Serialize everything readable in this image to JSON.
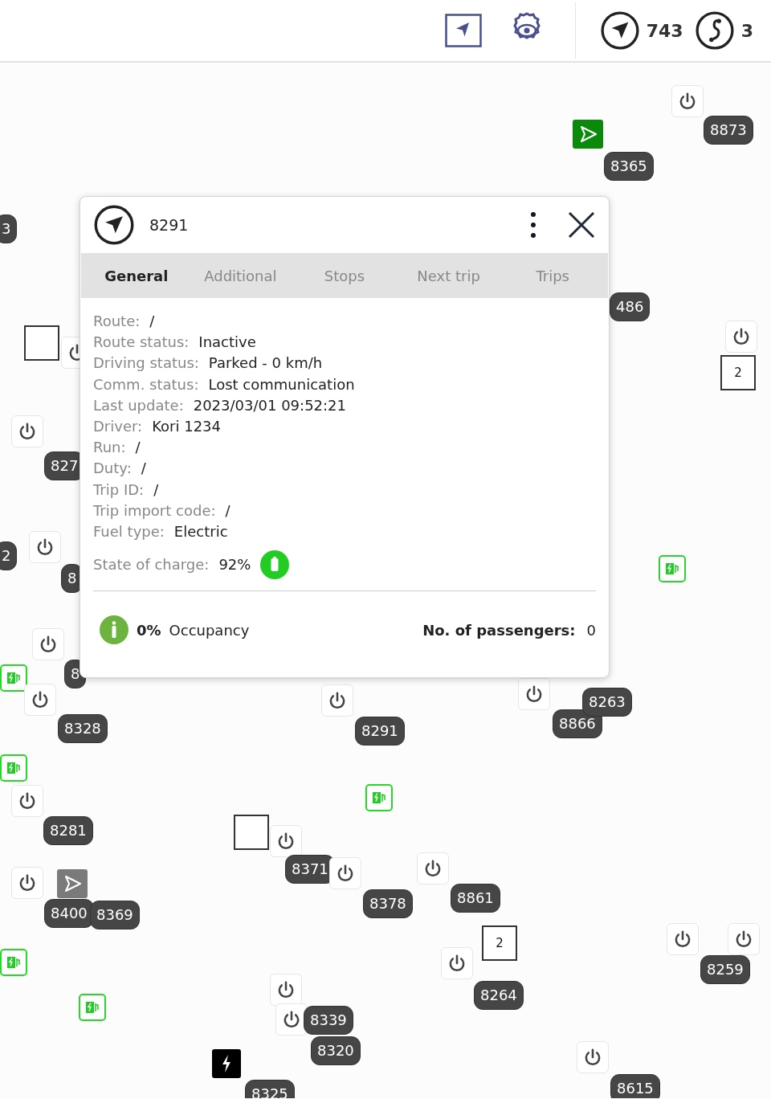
{
  "toolbar": {
    "counters": [
      {
        "kind": "vehicles",
        "count": "743"
      },
      {
        "kind": "routes",
        "count": "3"
      }
    ]
  },
  "map": {
    "markers": [
      {
        "kind": "power"
      },
      {
        "kind": "label",
        "text": "8873"
      },
      {
        "kind": "arrow",
        "active": true
      },
      {
        "kind": "label",
        "text": "8365"
      },
      {
        "kind": "label",
        "text": "3"
      },
      {
        "kind": "label",
        "text": "486"
      },
      {
        "kind": "box"
      },
      {
        "kind": "power"
      },
      {
        "kind": "box",
        "text": "2"
      },
      {
        "kind": "power"
      },
      {
        "kind": "power"
      },
      {
        "kind": "label",
        "text": "827"
      },
      {
        "kind": "label",
        "text": "2"
      },
      {
        "kind": "power"
      },
      {
        "kind": "label",
        "text": "8"
      },
      {
        "kind": "charger"
      },
      {
        "kind": "power"
      },
      {
        "kind": "label",
        "text": "8"
      },
      {
        "kind": "charger"
      },
      {
        "kind": "power"
      },
      {
        "kind": "label",
        "text": "8328"
      },
      {
        "kind": "power"
      },
      {
        "kind": "label",
        "text": "8291"
      },
      {
        "kind": "power"
      },
      {
        "kind": "label",
        "text": "8866"
      },
      {
        "kind": "label",
        "text": "8263"
      },
      {
        "kind": "charger"
      },
      {
        "kind": "power"
      },
      {
        "kind": "label",
        "text": "8281"
      },
      {
        "kind": "charger"
      },
      {
        "kind": "box"
      },
      {
        "kind": "power"
      },
      {
        "kind": "label",
        "text": "8371"
      },
      {
        "kind": "power"
      },
      {
        "kind": "power"
      },
      {
        "kind": "label",
        "text": "8378"
      },
      {
        "kind": "label",
        "text": "8861"
      },
      {
        "kind": "power"
      },
      {
        "kind": "arrow",
        "active": false
      },
      {
        "kind": "label",
        "text": "8400"
      },
      {
        "kind": "label",
        "text": "8369"
      },
      {
        "kind": "box",
        "text": "2"
      },
      {
        "kind": "power"
      },
      {
        "kind": "label",
        "text": "8264"
      },
      {
        "kind": "power"
      },
      {
        "kind": "power"
      },
      {
        "kind": "label",
        "text": "8259"
      },
      {
        "kind": "charger"
      },
      {
        "kind": "charger"
      },
      {
        "kind": "power"
      },
      {
        "kind": "power"
      },
      {
        "kind": "label",
        "text": "8339"
      },
      {
        "kind": "label",
        "text": "8320"
      },
      {
        "kind": "bolt"
      },
      {
        "kind": "label",
        "text": "8325"
      },
      {
        "kind": "power"
      },
      {
        "kind": "label",
        "text": "8615"
      }
    ]
  },
  "popup": {
    "vehicle": "8291",
    "tabs": [
      {
        "label": "General",
        "selected": true
      },
      {
        "label": "Additional",
        "selected": false
      },
      {
        "label": "Stops",
        "selected": false
      },
      {
        "label": "Next trip",
        "selected": false
      },
      {
        "label": "Trips",
        "selected": false
      }
    ],
    "fields": [
      {
        "label": "Route:",
        "value": "/"
      },
      {
        "label": "Route status:",
        "value": "Inactive"
      },
      {
        "label": "Driving status:",
        "value": "Parked - 0 km/h"
      },
      {
        "label": "Comm. status:",
        "value": "Lost communication"
      },
      {
        "label": "Last update:",
        "value": "2023/03/01 09:52:21"
      },
      {
        "label": "Driver:",
        "value": "Kori 1234"
      },
      {
        "label": "Run:",
        "value": "/"
      },
      {
        "label": "Duty:",
        "value": "/"
      },
      {
        "label": "Trip ID:",
        "value": "/"
      },
      {
        "label": "Trip import code:",
        "value": "/"
      },
      {
        "label": "Fuel type:",
        "value": "Electric"
      }
    ],
    "charge": {
      "label": "State of charge:",
      "value": "92%"
    },
    "occupancy": {
      "percent": "0%",
      "label": "Occupancy"
    },
    "passengers": {
      "label": "No. of passengers:",
      "value": "0"
    }
  }
}
